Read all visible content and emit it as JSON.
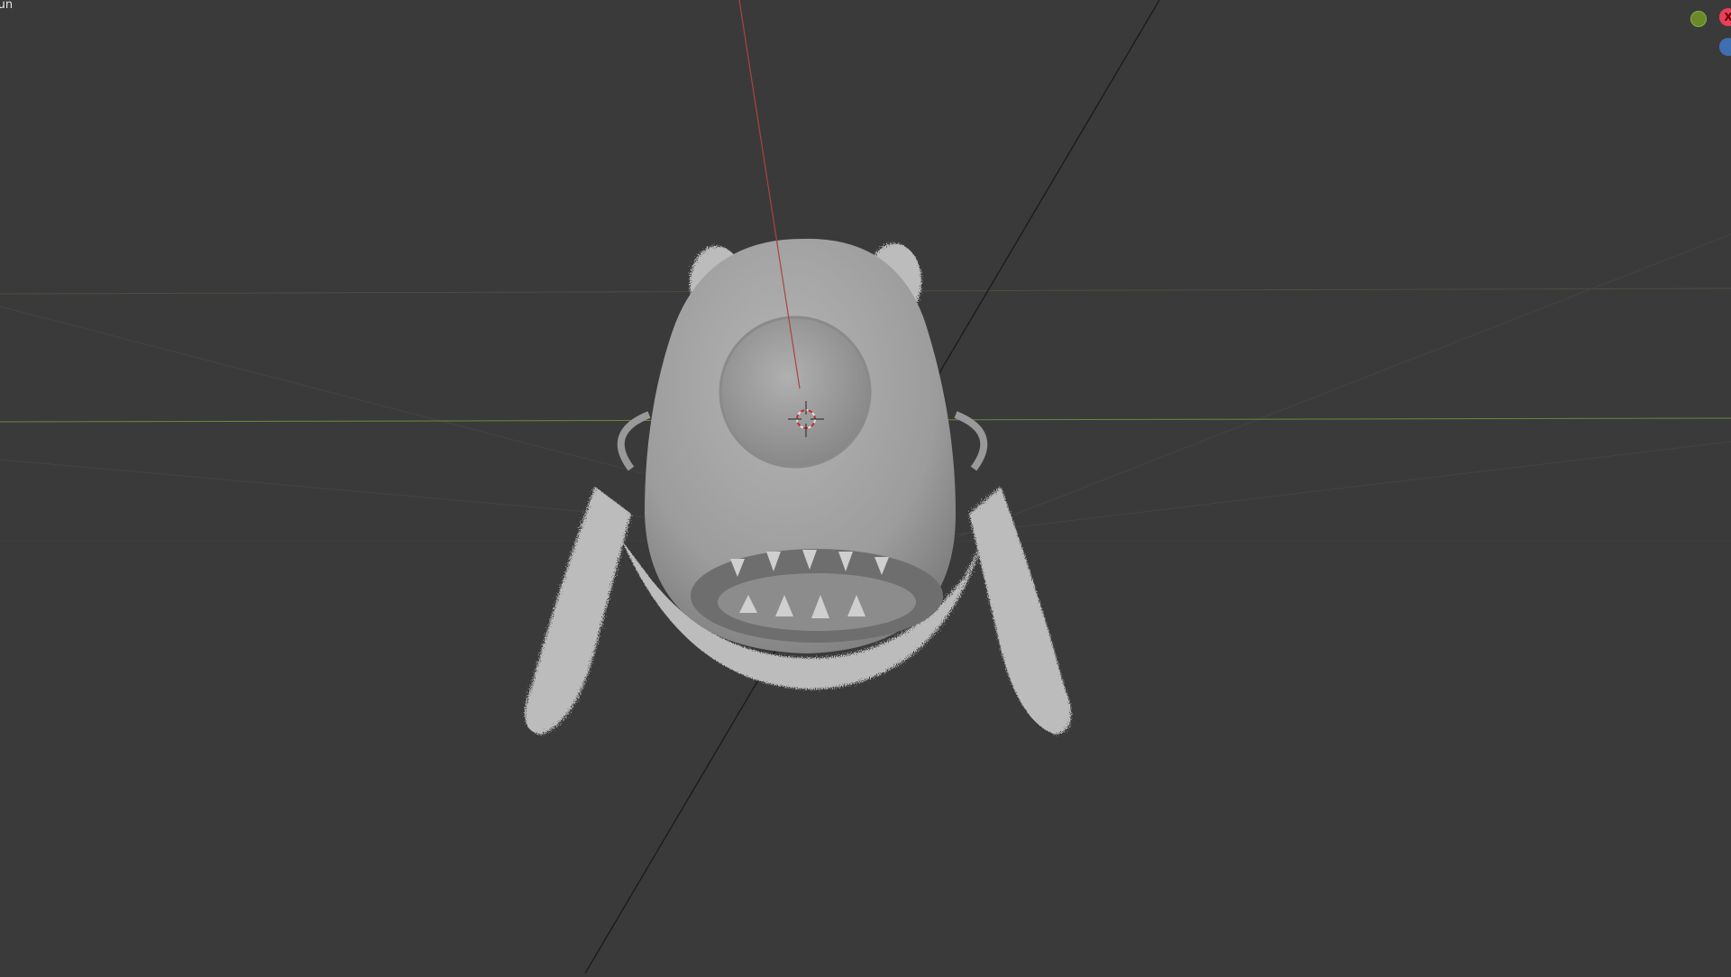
{
  "viewport": {
    "object_label": "iun",
    "gizmo": {
      "y_axis_color": "#7a9a30",
      "x_axis_color": "#e8405a",
      "x_axis_label": "X",
      "z_axis_color": "#3f6fb0"
    },
    "colors": {
      "background": "#3a3a3a",
      "model": "#a9a9a9",
      "fur": "#bdbdbd"
    }
  }
}
